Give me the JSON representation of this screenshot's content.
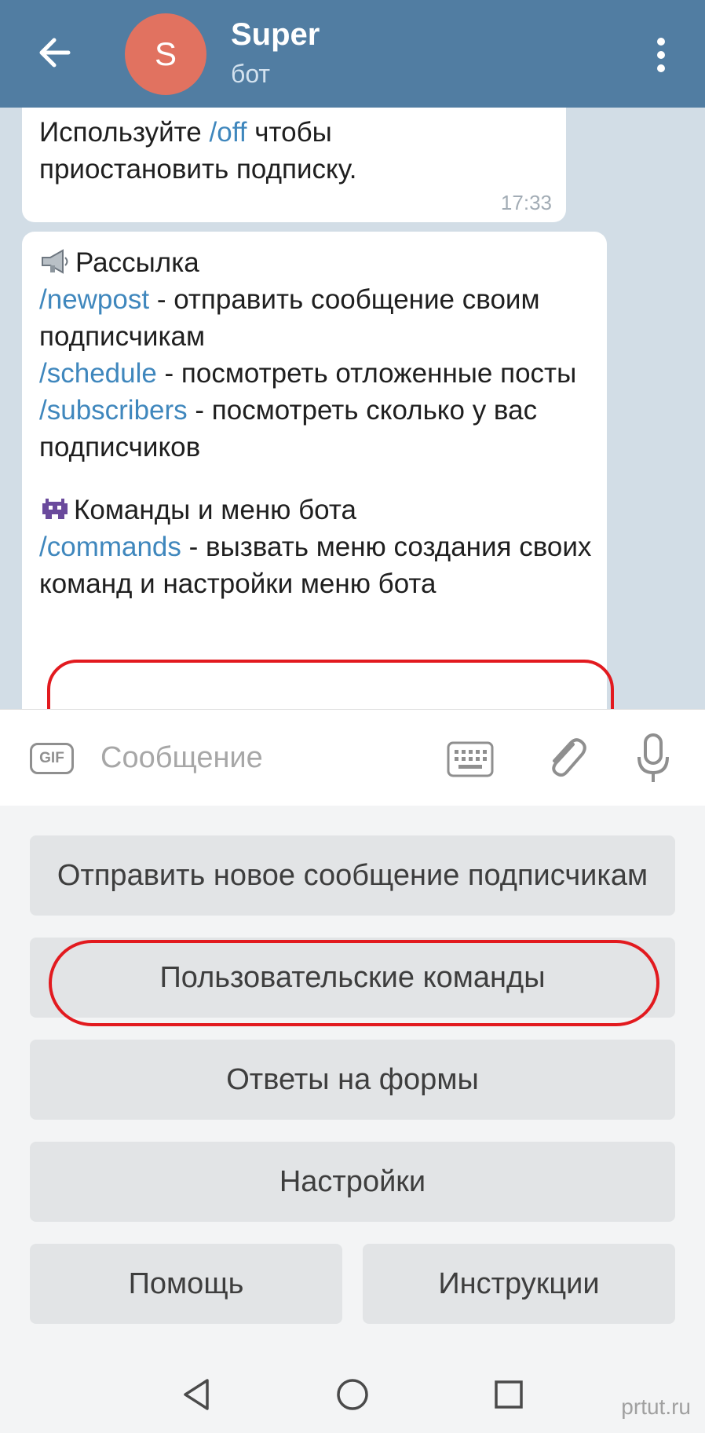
{
  "header": {
    "avatar_letter": "S",
    "title": "Super",
    "subtitle": "бот",
    "back_icon": "arrow-left-icon",
    "menu_icon": "more-vertical-icon"
  },
  "messages": {
    "first": {
      "prefix": "Используйте ",
      "command": "/off",
      "suffix": " чтобы приостановить подписку.",
      "time": "17:33"
    },
    "second": {
      "section1_icon": "megaphone-icon",
      "section1_title": "Рассылка",
      "items": [
        {
          "command": "/newpost",
          "desc": " - отправить сообщение своим подписчикам"
        },
        {
          "command": "/schedule",
          "desc": " - посмотреть отложенные посты"
        },
        {
          "command": "/subscribers",
          "desc": " - посмотреть сколько у вас подписчиков"
        }
      ],
      "section2_icon": "alien-monster-icon",
      "section2_title": "Команды и меню бота",
      "section2_command": "/commands",
      "section2_desc": " - вызвать меню создания своих команд и настройки меню бота"
    }
  },
  "input": {
    "gif_label": "GIF",
    "placeholder": "Сообщение",
    "icons": [
      "keyboard-icon",
      "paperclip-icon",
      "microphone-icon"
    ]
  },
  "keyboard": {
    "buttons": [
      "Отправить новое сообщение подписчикам",
      "Пользовательские команды",
      "Ответы на формы",
      "Настройки",
      "Помощь",
      "Инструкции"
    ]
  },
  "nav": {
    "icons": [
      "nav-back-icon",
      "nav-home-icon",
      "nav-recents-icon"
    ]
  },
  "watermark": "prtut.ru",
  "colors": {
    "header": "#517da2",
    "avatar": "#e17260",
    "link": "#3f87bd",
    "highlight": "#e21a1f",
    "chat_background": "#d2dde6"
  }
}
